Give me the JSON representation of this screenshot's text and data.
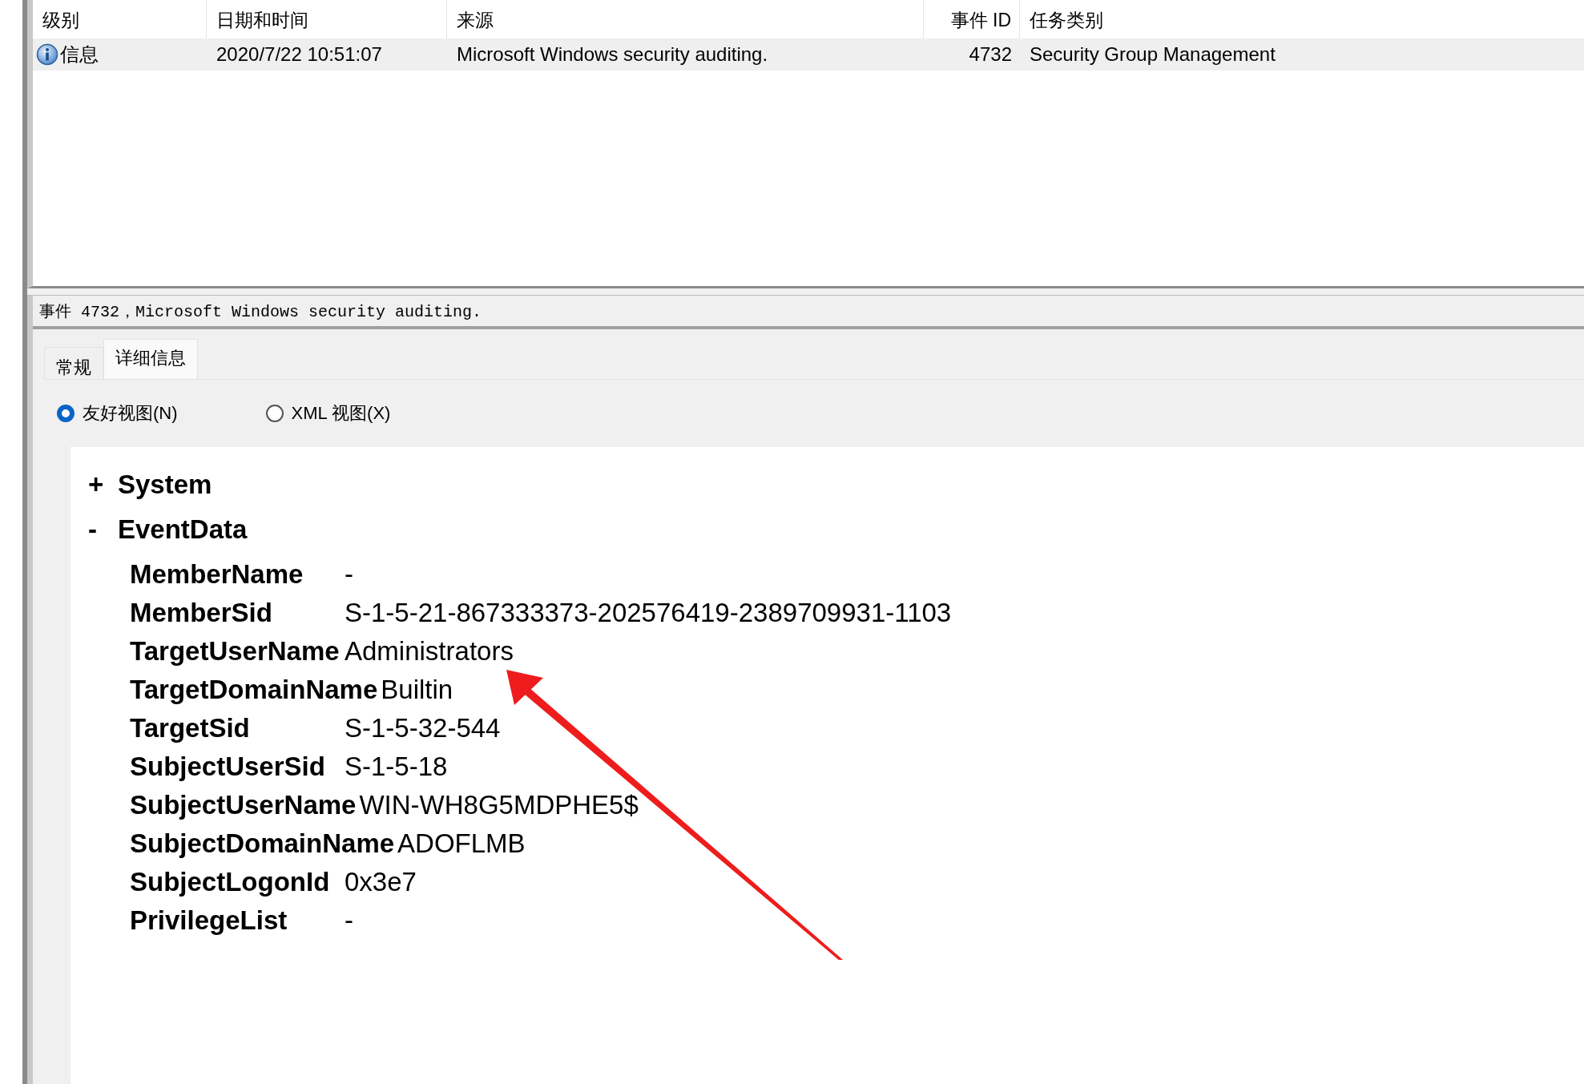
{
  "event_list": {
    "columns": [
      {
        "label": "级别",
        "kind": "text"
      },
      {
        "label": "日期和时间",
        "kind": "text"
      },
      {
        "label": "来源",
        "kind": "text"
      },
      {
        "label": "事件 ID",
        "kind": "number"
      },
      {
        "label": "任务类别",
        "kind": "text"
      }
    ],
    "rows": [
      {
        "selected": true,
        "cells": [
          "信息",
          "2020/7/22 10:51:07",
          "Microsoft Windows security auditing.",
          "4732",
          "Security Group Management"
        ]
      }
    ]
  },
  "details": {
    "title": "事件 4732，Microsoft Windows security auditing.",
    "tabs": [
      {
        "label": "常规",
        "selected": false
      },
      {
        "label": "详细信息",
        "selected": true
      }
    ],
    "views": [
      {
        "label": "友好视图(N)",
        "selected": true
      },
      {
        "label": "XML 视图(X)",
        "selected": false
      }
    ],
    "tree": [
      {
        "toggle": "+",
        "label": "System"
      },
      {
        "toggle": "-",
        "label": "EventData",
        "children": [
          {
            "name": "MemberName",
            "value": "-"
          },
          {
            "name": "MemberSid",
            "value": "S-1-5-21-867333373-202576419-2389709931-1103"
          },
          {
            "name": "TargetUserName",
            "value": "Administrators"
          },
          {
            "name": "TargetDomainName",
            "value": "Builtin"
          },
          {
            "name": "TargetSid",
            "value": "S-1-5-32-544"
          },
          {
            "name": "SubjectUserSid",
            "value": "S-1-5-18"
          },
          {
            "name": "SubjectUserName",
            "value": "WIN-WH8G5MDPHE5$"
          },
          {
            "name": "SubjectDomainName",
            "value": "ADOFLMB"
          },
          {
            "name": "SubjectLogonId",
            "value": "0x3e7"
          },
          {
            "name": "PrivilegeList",
            "value": "-"
          }
        ]
      }
    ]
  }
}
